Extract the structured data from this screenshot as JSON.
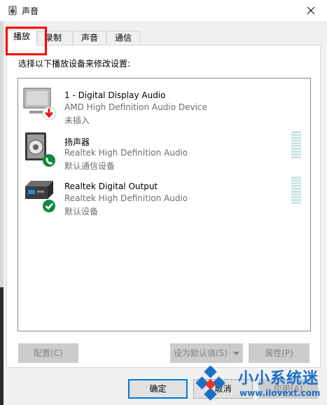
{
  "window": {
    "title": "声音",
    "close_icon": "close-icon"
  },
  "tabs": [
    {
      "label": "播放",
      "active": true
    },
    {
      "label": "录制",
      "active": false
    },
    {
      "label": "声音",
      "active": false
    },
    {
      "label": "通信",
      "active": false
    }
  ],
  "panel": {
    "instruction": "选择以下播放设备来修改设置:"
  },
  "devices": [
    {
      "name": "1 - Digital Display Audio",
      "description": "AMD High Definition Audio Device",
      "status": "未插入",
      "icon": "monitor-speaker-icon",
      "badge": "unplugged-down-arrow-icon",
      "badge_color": "#e81123",
      "meter": false
    },
    {
      "name": "扬声器",
      "description": "Realtek High Definition Audio",
      "status": "默认通信设备",
      "icon": "speaker-icon",
      "badge": "phone-badge-icon",
      "badge_color": "#10893e",
      "meter": true
    },
    {
      "name": "Realtek Digital Output",
      "description": "Realtek High Definition Audio",
      "status": "默认设备",
      "icon": "digital-output-icon",
      "badge": "check-badge-icon",
      "badge_color": "#10893e",
      "meter": true
    }
  ],
  "buttons": {
    "configure": "配置(C)",
    "set_default": "设为默认值(S)",
    "properties": "属性(P)",
    "ok": "确定",
    "cancel": "取消",
    "apply": "应用(A)"
  },
  "watermark": {
    "title": "小小系统迷",
    "url": "www.ilovext.com"
  },
  "colors": {
    "tab_highlight": "#ff0000",
    "accent": "#0078d7",
    "status_green": "#10893e",
    "status_red": "#e81123",
    "watermark_blue": "#1a6fc9"
  }
}
